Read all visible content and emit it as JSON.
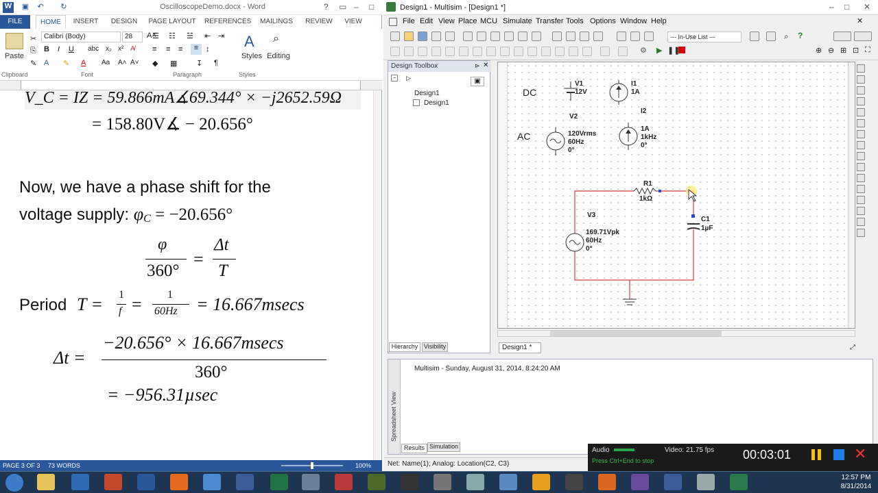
{
  "word": {
    "title": "OscilloscopeDemo.docx - Word",
    "tabs": [
      "FILE",
      "HOME",
      "INSERT",
      "DESIGN",
      "PAGE LAYOUT",
      "REFERENCES",
      "MAILINGS",
      "REVIEW",
      "VIEW"
    ],
    "font_name": "Calibri (Body)",
    "font_size": "28",
    "paste_label": "Paste",
    "styles_label": "Styles",
    "editing_label": "Editing",
    "groups": {
      "clipboard": "Clipboard",
      "font": "Font",
      "paragraph": "Paragraph",
      "styles": "Styles"
    },
    "doc": {
      "line0": "V_C = IZ = 59.866mA∡69.344° × −j2652.59Ω",
      "line1": "= 158.80V∡ − 20.656°",
      "para1a": "Now, we have a phase shift for the",
      "para1b": "voltage supply: ",
      "phi_c": "φ",
      "phi_sub": "C",
      "phi_val": " = −20.656°",
      "frac1_num": "φ",
      "frac1_den": "360°",
      "eq": "=",
      "frac2_num": "Δt",
      "frac2_den": "T",
      "period_label": "Period ",
      "period_T": "T =",
      "p_num1": "1",
      "p_den1": "f",
      "p_num2": "1",
      "p_den2": "60Hz",
      "period_val": "= 16.667msecs",
      "dt_label": "Δt =",
      "dt_num": "−20.656° × 16.667msecs",
      "dt_den": "360°",
      "dt_result": "= −956.31µsec"
    },
    "status": {
      "page": "PAGE 3 OF 3",
      "words": "73 WORDS",
      "zoom": "100%"
    }
  },
  "multisim": {
    "title": "Design1 - Multisim - [Design1 *]",
    "menu": [
      "File",
      "Edit",
      "View",
      "Place",
      "MCU",
      "Simulate",
      "Transfer",
      "Tools",
      "Options",
      "Window",
      "Help"
    ],
    "in_use_list": "--- In-Use List ---",
    "toolbox_title": "Design Toolbox",
    "tree": [
      "Design1",
      "Design1"
    ],
    "toolbox_tabs": [
      "Hierarchy",
      "Visibility"
    ],
    "design_tab": "Design1 *",
    "schematic": {
      "dc_label": "DC",
      "ac_label": "AC",
      "v1": [
        "V1",
        "12V"
      ],
      "i1": [
        "I1",
        "1A"
      ],
      "v2": [
        "V2",
        "120Vrms",
        "60Hz",
        "0°"
      ],
      "i2": [
        "I2",
        "1A",
        "1kHz",
        "0°"
      ],
      "r1": [
        "R1",
        "1kΩ"
      ],
      "v3": [
        "V3",
        "169.71Vpk",
        "60Hz",
        "0°"
      ],
      "c1": [
        "C1",
        "1µF"
      ]
    },
    "spreadsheet_msg": "Multisim  -  Sunday, August 31, 2014, 8:24:20 AM",
    "spreadsheet_label": "Spreadsheet View",
    "spread_tabs": [
      "Results",
      "Simulation"
    ],
    "status": "Net: Name(1); Analog: Location(C2, C3)"
  },
  "recorder": {
    "audio": "Audio",
    "video": "Video: 21.75 fps",
    "hint": "Press Ctrl+End to stop",
    "time": "00:03:01"
  },
  "taskbar": {
    "time": "12:57 PM",
    "date": "8/31/2014"
  }
}
